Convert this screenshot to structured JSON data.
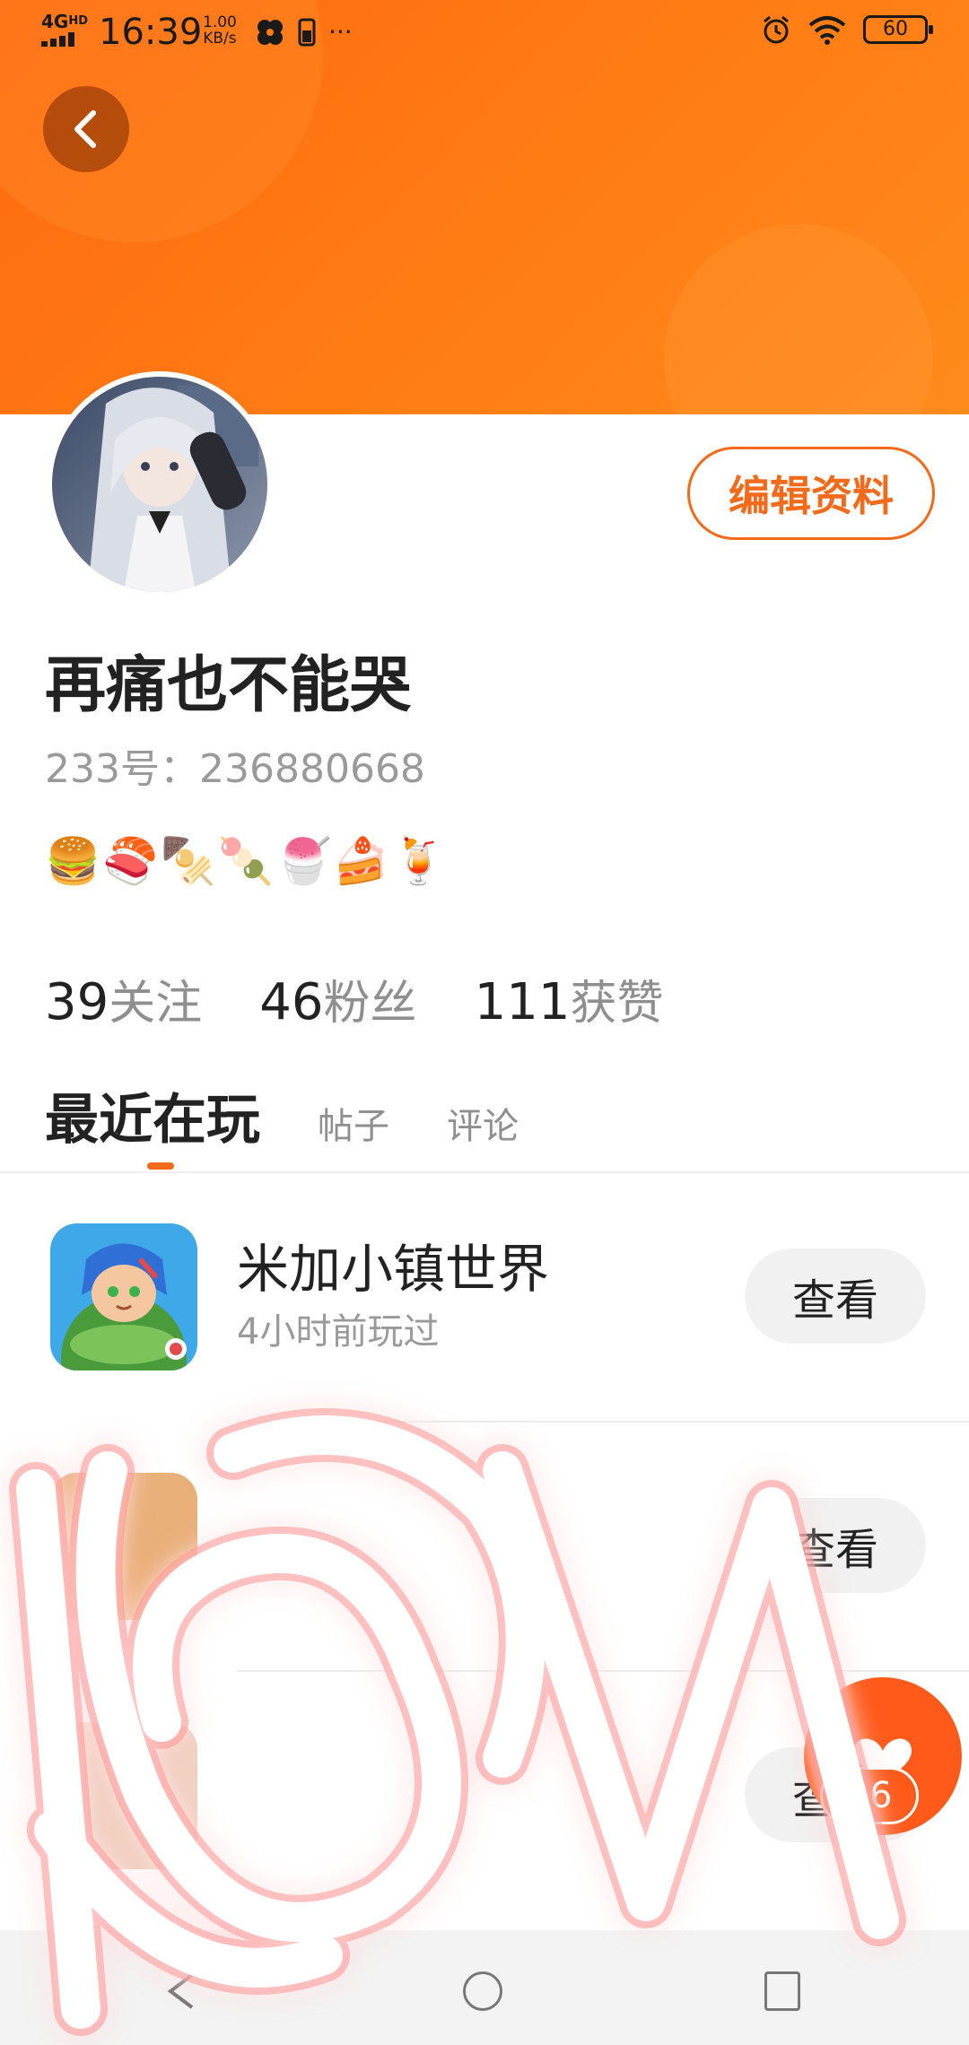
{
  "status_bar": {
    "network": "4G",
    "network_hd": "HD",
    "time": "16:39",
    "speed_value": "1.00",
    "speed_unit": "KB/s",
    "more": "···",
    "battery": "60"
  },
  "profile": {
    "username": "再痛也不能哭",
    "uid_text": "233号：236880668",
    "emoji_line": "🍔🍣🍢🍡🍧🍰🍹",
    "edit_label": "编辑资料",
    "stats": [
      {
        "num": "39",
        "label": "关注"
      },
      {
        "num": "46",
        "label": "粉丝"
      },
      {
        "num": "111",
        "label": "获赞"
      }
    ]
  },
  "tabs": {
    "active": "最近在玩",
    "items": [
      "帖子",
      "评论"
    ]
  },
  "games": [
    {
      "title": "米加小镇世界",
      "subtitle": "4小时前玩过",
      "button": "查看"
    },
    {
      "title": "",
      "subtitle": "",
      "button": "查看"
    },
    {
      "title": "",
      "subtitle": "",
      "button": "查看"
    }
  ],
  "fab": {
    "count": "26"
  },
  "colors": {
    "accent": "#ff6a10",
    "accent_text": "#f26a1a",
    "muted": "#9a9a9a"
  }
}
